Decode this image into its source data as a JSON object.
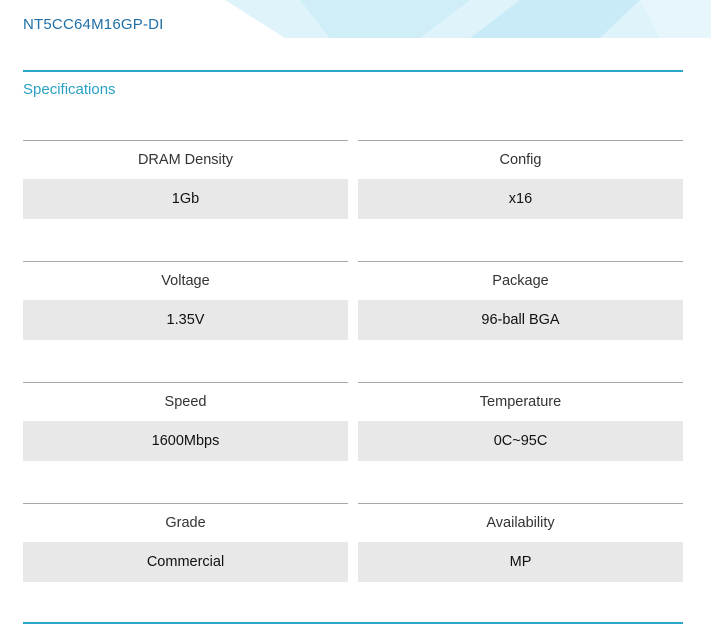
{
  "product": {
    "part_number": "NT5CC64M16GP-DI"
  },
  "specifications": {
    "title": "Specifications",
    "items": [
      {
        "label": "DRAM Density",
        "value": "1Gb"
      },
      {
        "label": "Config",
        "value": "x16"
      },
      {
        "label": "Voltage",
        "value": "1.35V"
      },
      {
        "label": "Package",
        "value": "96-ball BGA"
      },
      {
        "label": "Speed",
        "value": "1600Mbps"
      },
      {
        "label": "Temperature",
        "value": "0C~95C"
      },
      {
        "label": "Grade",
        "value": "Commercial"
      },
      {
        "label": "Availability",
        "value": "MP"
      }
    ]
  },
  "colors": {
    "accent": "#2aa7c9",
    "part_number_text": "#1f6fa8",
    "value_background": "#e8e8e8",
    "decor_light": "#d6f0f8"
  }
}
